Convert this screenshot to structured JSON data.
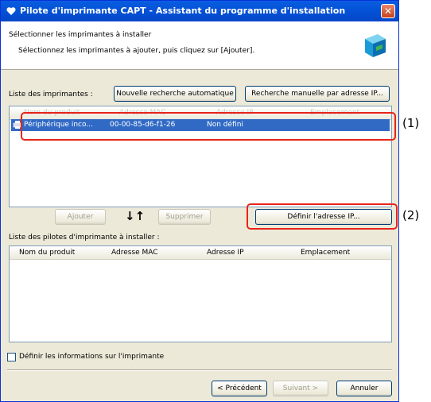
{
  "window": {
    "title": "Pilote d'imprimante CAPT - Assistant du programme d'installation"
  },
  "header": {
    "title": "Sélectionner les imprimantes à installer",
    "subtitle": "Sélectionnez les imprimantes à ajouter, puis cliquez sur [Ajouter]."
  },
  "printer_list": {
    "label": "Liste des imprimantes :",
    "auto_search_button": "Nouvelle recherche automatique",
    "manual_search_button": "Recherche manuelle par adresse IP...",
    "columns": [
      "Nom du produit",
      "Adresse MAC",
      "Adresse IP",
      "Emplacement"
    ],
    "rows": [
      {
        "name": "Périphérique inco...",
        "mac": "00-00-85-d6-f1-26",
        "ip": "Non défini",
        "location": ""
      }
    ]
  },
  "buttons": {
    "add": "Ajouter",
    "remove": "Supprimer",
    "set_ip": "Définir l'adresse IP...",
    "back": "< Précédent",
    "next": "Suivant >",
    "cancel": "Annuler"
  },
  "install_list": {
    "label": "Liste des pilotes d'imprimante à installer :",
    "columns": [
      "Nom du produit",
      "Adresse MAC",
      "Adresse IP",
      "Emplacement"
    ]
  },
  "checkbox": {
    "label": "Définir les informations sur l'imprimante",
    "checked": false
  },
  "callouts": {
    "one": "(1)",
    "two": "(2)"
  }
}
